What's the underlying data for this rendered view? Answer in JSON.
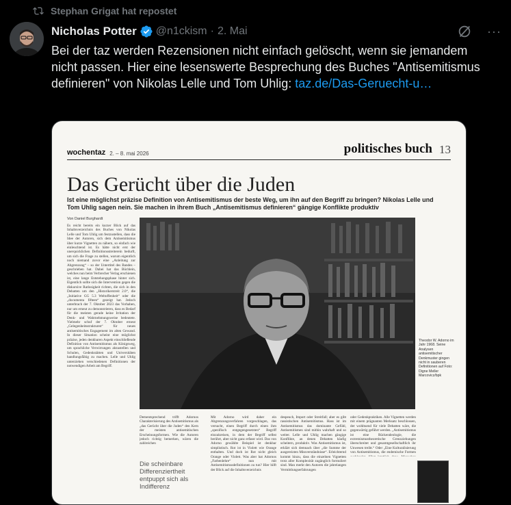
{
  "repost": {
    "label": "Stephan Grigat hat repostet"
  },
  "author": {
    "name": "Nicholas Potter",
    "handle": "@n1ckism",
    "dot": "·",
    "date": "2. Mai"
  },
  "tweet": {
    "text": "Bei der taz werden Rezensionen nicht einfach gelöscht, wenn sie jemandem nicht passen. Hier eine lesenswerte Besprechung des Buches \"Antisemitismus definieren\" von Nikolas Lelle und Tom Uhlig: ",
    "link": "taz.de/Das-Geruecht-u…"
  },
  "header_actions": {
    "more": "···"
  },
  "newspaper": {
    "brand": "wochentaz",
    "date": "2. – 8. mai 2026",
    "section": "politisches buch",
    "page": "13",
    "headline": "Das Gerücht über die Juden",
    "subheadline": "Ist eine möglichst präzise Definition von Antisemitismus der beste Weg, um ihn auf den Begriff zu bringen? Nikolas Lelle und Tom Uhlig sagen nein. Sie machen in ihrem Buch „Antisemitismus definieren“ gängige Konflikte produktiv",
    "byline": "Von Daniel Burghardt",
    "col1": "Es reicht bereits ein kurzer Blick auf das Inhaltsverzeichnis des Buches von Nikolas Lelle und Tom Uhlig um festzustellen, dass die Idee der Autoren, sich dem Antisemitismus über kurze Vignetten zu nähern, so einfach wie einleuchtend ist. Es hätte nicht erst der unerquicklichen Definitionsstreiterein bedurft, um sich die Frage zu stellen, warum eigentlich noch niemand zuvor eine „Anleitung zur Abgrenzung“ – so der Untertitel des Bandes – geschrieben hat. Dabei hat das Büchlein, welches nun beim Verbrecher Verlag erschienen ist, eine lange Entstehungsphase hinter sich. Eigentlich sollte sich die Intervention gegen die diskursive Ratlosigkeit richten, die sich in den Debatten um den „Historikerstreit 2.0“, die „Initiative GG 5.3 Weltoffenheit“ oder die „documenta fifteen“ gezeigt hat. Jedoch unterbrach der 7. Oktober 2023 das Vorhaben, nur um erneut zu demonstrieren, dass es Bedarf für die meisten gerade keine Irritation der Denk- und Wahrnehmungsweise bedeutete. Vielmehr schuf der 7. Oktober erneut „Gelegenheitsstrukturen“ für neues antisemitisches Engagement im alten Gewand. In dieser Situation scheint eine möglichst präzise, jeden denkbaren Aspekt einschließende Definition von Antisemitismus als Königsweg, um sprachliche Verwirrungen abzustellen und Schulen, Gedenkstätten und Universitäten handlungsfähig zu machen. Lelle und Uhlig unterziehen verschiedenen Definitionen der notwendigen Arbeit am Begriff.",
    "col2": "Dementsprechend trifft Adornos Charakterisierung des Antisemitismus als „das Gerücht über die Juden“ den Kern der meisten antisemitischen Erscheinungsformen. Wie die Autoren jedoch richtig bemerken, wären die zahlreichen",
    "col3": "Mit Adorno wird daher ein Abgrenzungsverfahren vorgeschlagen, das versucht, einen Begriff durch einen ihm „spezifisch entgegengesetzten“ Begriff einzukreisen, in dem der Begriff selbst berührt, aber nicht ganz erfasst wird. Das von Adorno gewählte Beispiel ist denkbar simplistisch. Rot ist in Violett wie Orange enthalten. Und doch ist Rot nicht gleich Orange oder Violett. Was aber hat Adornos „Farbenlehre“ nun mit Antisemitismusdefinitionen zu tun? Hier hilft der Blick auf die Inhaltsverzeichnis",
    "col4": "despeuch, Import oder Streitfall; aber es gibt rassistischen Antisemitismus. Hass ist im Antisemitismus das dominante Gefühl, Antisemitismen sind mithin wahrhaft und so weiter. Lelle und Uhlig machen gängige Konflikte, an denen Debatten häufig scheitern, produktiv. Was Antisemitismus ist, erklärt sich demnach über „die Summe der ausgereizten Missverständnisse“. Erleichternd kommt hinzu, dass die einzelnen Vignetten trotz aller Komplexität zugänglich formuliert sind. Man merkt den Autoren die jahrelangen Vermittlungserfahrungen",
    "col5": "oder Gedenkpraktiken. Alle Vignetten werden mit einem prägnanten Merksatz beschlossen, der wohltuend für viele Debatten wäre, die gegenwärtig geführt werden. „Antisemitismus ist eine Rückendeologie, die extremismustheoretische Grenzziehungen überschreitet und gesamtgesellschaftlich ihr Unwesen treibt.“ Oder „Eine Kulturalisierung von Antisemitismus, die endemische Formen ausblendet, führt letztlich dazu, Menschen mit Migrationsgeschichten chiffrierten Judenhass nahezulegen, anstatt die Probleme zu bekämpfen“",
    "pullquote": "Die scheinbare Differenziertheit entpuppt sich als Indifferenz",
    "caption": "Theodor W. Adorno im Jahr 1968. Seine Analysen antisemitischer Denkmuster gingen nicht in sauberen Definitionen auf Foto: Digne Meller Marcovicz/bpk"
  },
  "colors": {
    "background": "#000000",
    "text": "#e7e9ea",
    "muted": "#71767b",
    "accent": "#1d9bf0"
  }
}
